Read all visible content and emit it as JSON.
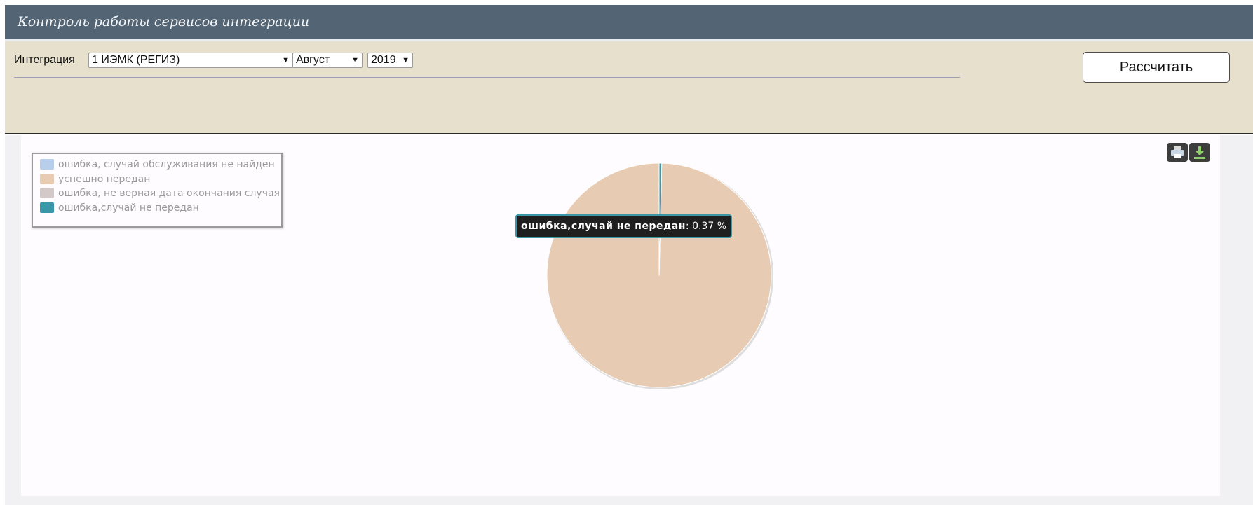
{
  "header": {
    "title": "Контроль работы сервисов интеграции"
  },
  "filters": {
    "integration_label": "Интеграция",
    "integration_value": "1 ИЭМК (РЕГИЗ)",
    "month_value": "Август",
    "year_value": "2019",
    "calculate_label": "Рассчитать"
  },
  "toolbar": {
    "print_icon": "printer-icon",
    "download_icon": "download-icon"
  },
  "chart_data": {
    "type": "pie",
    "unit": "%",
    "series": [
      {
        "name": "ошибка, случай обслуживания не найден",
        "value": 0,
        "color": "#b7cfeb"
      },
      {
        "name": "успешно передан",
        "value": 99.63,
        "color": "#e8cbb3"
      },
      {
        "name": "ошибка, не верная дата окончания случая",
        "value": 0,
        "color": "#d4c9c9"
      },
      {
        "name": "ошибка,случай не передан",
        "value": 0.37,
        "color": "#3a97a8"
      }
    ],
    "legend_position": "top-left",
    "tooltip": {
      "name": "ошибка,случай не передан",
      "value_text": ": 0.37 %"
    }
  }
}
